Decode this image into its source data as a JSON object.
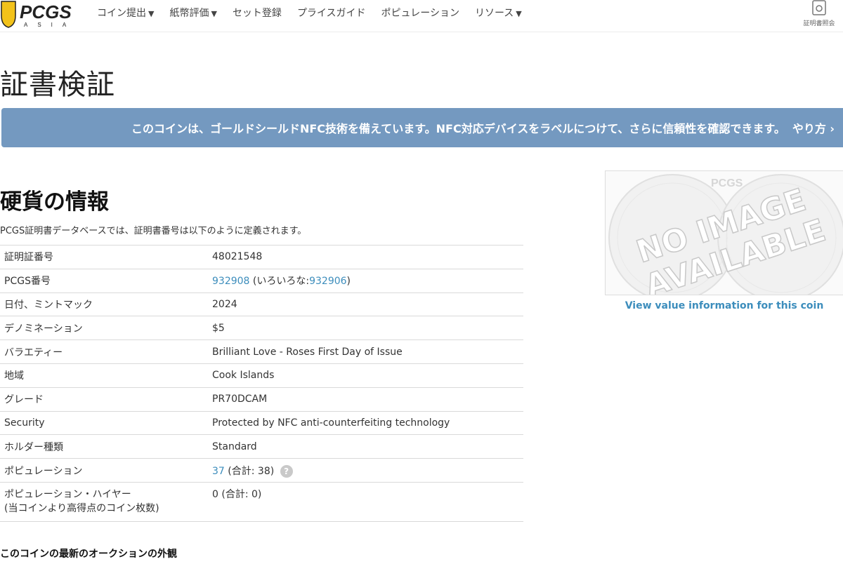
{
  "header": {
    "logo_text": "PCGS",
    "logo_sub": "ASIA",
    "nav": [
      {
        "label": "コイン提出",
        "caret": "▼"
      },
      {
        "label": "紙幣評価",
        "caret": "▼"
      },
      {
        "label": "セット登録",
        "caret": ""
      },
      {
        "label": "プライスガイド",
        "caret": ""
      },
      {
        "label": "ポピュレーション",
        "caret": ""
      },
      {
        "label": "リソース",
        "caret": "▼"
      }
    ],
    "cert_lookup_label": "証明書照会"
  },
  "page_title": "証書検証",
  "nfc_banner": {
    "text": "このコインは、ゴールドシールドNFC技術を備えています。NFC対応デバイスをラベルにつけて、さらに信頼性を確認できます。",
    "link": "やり方 ›"
  },
  "coin_info": {
    "title": "硬貨の情報",
    "description": "PCGS証明書データベースでは、証明書番号は以下のように定義されます。",
    "rows": {
      "cert": {
        "key": "証明証番号",
        "value": "48021548"
      },
      "pcgs": {
        "key": "PCGS番号",
        "value": "932908",
        "variety_prefix": "(いろいろな:",
        "variety_value": "932906",
        "variety_suffix": ")"
      },
      "date": {
        "key": "日付、ミントマック",
        "value": "2024"
      },
      "denom": {
        "key": "デノミネーション",
        "value": "$5"
      },
      "variety": {
        "key": "バラエティー",
        "value": "Brilliant Love - Roses First Day of Issue"
      },
      "region": {
        "key": "地域",
        "value": "Cook Islands"
      },
      "grade": {
        "key": "グレード",
        "value": "PR70DCAM"
      },
      "security": {
        "key": "Security",
        "value": "Protected by NFC anti-counterfeiting technology"
      },
      "holder": {
        "key": "ホルダー種類",
        "value": "Standard"
      },
      "population": {
        "key": "ポピュレーション",
        "value": "37",
        "total": "(合計: 38)"
      },
      "pop_higher": {
        "key": "ポピュレーション・ハイヤー",
        "key2": "(当コインより高得点のコイン枚数)",
        "value": "0",
        "total": "(合計: 0)"
      }
    }
  },
  "auction_title": "このコインの最新のオークションの外観",
  "image": {
    "no_image_line1": "NO IMAGE",
    "no_image_line2": "AVAILABLE",
    "watermark": "PCGS"
  },
  "value_link": "View value information for this coin"
}
